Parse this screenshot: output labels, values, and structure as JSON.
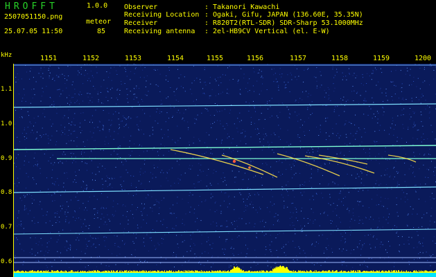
{
  "app": {
    "name": "HROFFT",
    "version": "1.0.0"
  },
  "file": {
    "name": "2507051150.png",
    "datetime": "25.07.05 11:50"
  },
  "detection": {
    "mode": "meteor",
    "count": "85"
  },
  "station": [
    {
      "label": "Observer",
      "value": ": Takanori Kawachi"
    },
    {
      "label": "Receiving Location",
      "value": ": Ogaki, Gifu, JAPAN (136.60E, 35.35N)"
    },
    {
      "label": "Receiver",
      "value": ": R820T2(RTL-SDR) SDR-Sharp 53.1000MHz"
    },
    {
      "label": "Receiving antenna",
      "value": ": 2el-HB9CV Vertical (el. E-W)"
    }
  ],
  "time_axis": {
    "labels": [
      "1151",
      "1152",
      "1153",
      "1154",
      "1155",
      "1156",
      "1157",
      "1158",
      "1159",
      "1200"
    ]
  },
  "freq_axis": {
    "unit": "kHz",
    "labels": [
      "1.1",
      "1.0",
      "0.9",
      "0.8",
      "0.7",
      "0.6"
    ]
  },
  "colors": {
    "text": "#ffff00",
    "title": "#28d228",
    "background": "#0a1a5a",
    "signal": "#7fffd4",
    "amplitude": "#ffff00"
  }
}
